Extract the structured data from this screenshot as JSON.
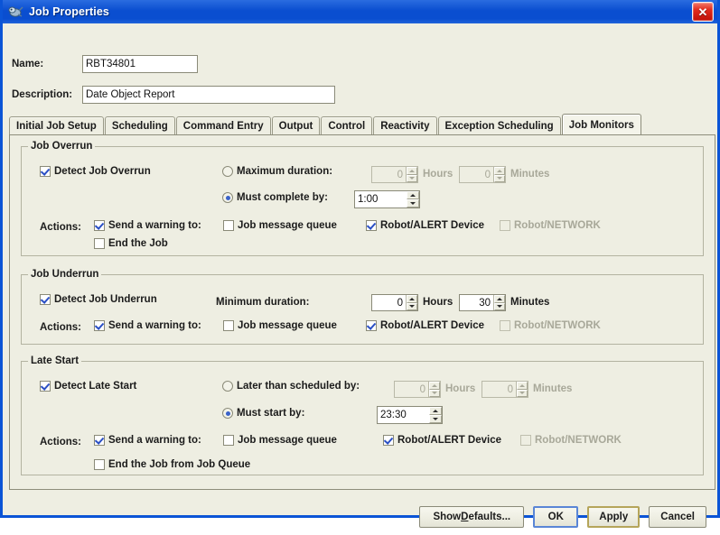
{
  "window": {
    "title": "Job Properties",
    "icon": "app-icon",
    "close_label": "✕",
    "accent_titlebar": "#0a4ed0",
    "background": "#eeeee2"
  },
  "form": {
    "name_label": "Name:",
    "name_value": "RBT34801",
    "description_label": "Description:",
    "description_value": "Date Object Report"
  },
  "tabs": [
    {
      "label": "Initial Job Setup",
      "selected": false
    },
    {
      "label": "Scheduling",
      "selected": false
    },
    {
      "label": "Command Entry",
      "selected": false
    },
    {
      "label": "Output",
      "selected": false
    },
    {
      "label": "Control",
      "selected": false
    },
    {
      "label": "Reactivity",
      "selected": false
    },
    {
      "label": "Exception Scheduling",
      "selected": false
    },
    {
      "label": "Job Monitors",
      "selected": true
    }
  ],
  "job_overrun": {
    "title": "Job Overrun",
    "detect_label": "Detect Job Overrun",
    "detect_checked": true,
    "max_duration_label": "Maximum duration:",
    "max_duration_selected": false,
    "max_hours": "0",
    "hours_unit": "Hours",
    "max_minutes": "0",
    "minutes_unit": "Minutes",
    "must_complete_label": "Must complete by:",
    "must_complete_selected": true,
    "must_complete_time": "1:00",
    "actions_label": "Actions:",
    "send_warning_label": "Send a warning to:",
    "send_warning_checked": true,
    "job_message_queue_label": "Job message queue",
    "job_message_queue_checked": false,
    "robot_alert_label": "Robot/ALERT Device",
    "robot_alert_checked": true,
    "robot_network_label": "Robot/NETWORK",
    "robot_network_checked": false,
    "end_job_label": "End the Job",
    "end_job_checked": false
  },
  "job_underrun": {
    "title": "Job Underrun",
    "detect_label": "Detect Job Underrun",
    "detect_checked": true,
    "min_duration_label": "Minimum duration:",
    "min_hours": "0",
    "hours_unit": "Hours",
    "min_minutes": "30",
    "minutes_unit": "Minutes",
    "actions_label": "Actions:",
    "send_warning_label": "Send a warning to:",
    "send_warning_checked": true,
    "job_message_queue_label": "Job message queue",
    "job_message_queue_checked": false,
    "robot_alert_label": "Robot/ALERT Device",
    "robot_alert_checked": true,
    "robot_network_label": "Robot/NETWORK",
    "robot_network_checked": false
  },
  "late_start": {
    "title": "Late Start",
    "detect_label": "Detect Late Start",
    "detect_checked": true,
    "later_than_label": "Later than scheduled by:",
    "later_than_selected": false,
    "later_hours": "0",
    "hours_unit": "Hours",
    "later_minutes": "0",
    "minutes_unit": "Minutes",
    "must_start_label": "Must start by:",
    "must_start_selected": true,
    "must_start_time": "23:30",
    "actions_label": "Actions:",
    "send_warning_label": "Send a warning to:",
    "send_warning_checked": true,
    "job_message_queue_label": "Job message queue",
    "job_message_queue_checked": false,
    "robot_alert_label": "Robot/ALERT Device",
    "robot_alert_checked": true,
    "robot_network_label": "Robot/NETWORK",
    "robot_network_checked": false,
    "end_job_queue_label": "End the Job from Job Queue",
    "end_job_queue_checked": false
  },
  "buttons": {
    "show_defaults_pre": "Show ",
    "show_defaults_mnemonic": "D",
    "show_defaults_post": "efaults...",
    "ok": "OK",
    "apply": "Apply",
    "cancel": "Cancel"
  }
}
